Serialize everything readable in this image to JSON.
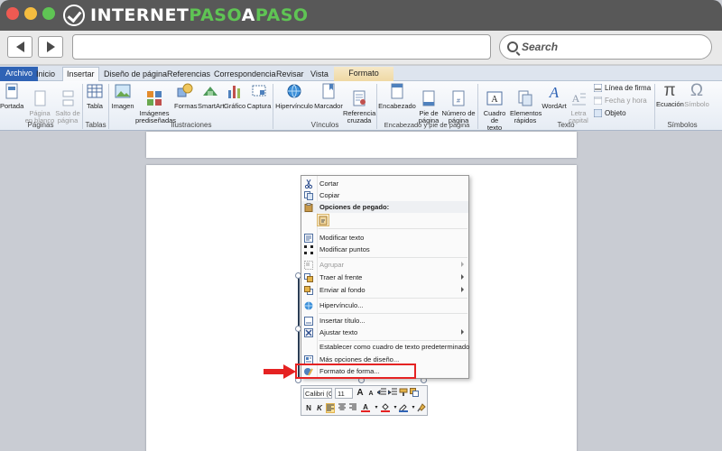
{
  "brand": {
    "part1": "INTERNET",
    "part2": "PASO",
    "mid": "A",
    "part3": "PASO",
    "accent": "#5fc454"
  },
  "browser": {
    "search_label": "Search"
  },
  "ribbon": {
    "tabs": [
      {
        "label": "Archivo",
        "kind": "file"
      },
      {
        "label": "Inicio"
      },
      {
        "label": "Insertar",
        "kind": "active"
      },
      {
        "label": "Diseño de página"
      },
      {
        "label": "Referencias"
      },
      {
        "label": "Correspondencia"
      },
      {
        "label": "Revisar"
      },
      {
        "label": "Vista"
      },
      {
        "label": "Formato",
        "kind": "ctx"
      }
    ],
    "buttons": {
      "portada": "Portada",
      "pagina_blanco": "Página\nen blanco",
      "salto_pagina": "Salto de\npágina",
      "tabla": "Tabla",
      "imagen": "Imagen",
      "imagenes_pre": "Imágenes\nprediseñadas",
      "formas": "Formas",
      "smartart": "SmartArt",
      "grafico": "Gráfico",
      "captura": "Captura",
      "hipervinculo": "Hipervínculo",
      "marcador": "Marcador",
      "referencia": "Referencia\ncruzada",
      "encabezado": "Encabezado",
      "pie_pagina": "Pie de\npágina",
      "numero_pagina": "Número de\npágina",
      "cuadro_texto": "Cuadro de\ntexto",
      "elementos_rapidos": "Elementos\nrápidos",
      "wordart": "WordArt",
      "letra_capital": "Letra\ncapital",
      "linea_firma": "Línea de firma",
      "fecha_hora": "Fecha y hora",
      "objeto": "Objeto",
      "ecuacion": "Ecuación",
      "simbolo": "Símbolo"
    },
    "groups": {
      "paginas": "Páginas",
      "tablas": "Tablas",
      "ilustraciones": "Ilustraciones",
      "vinculos": "Vínculos",
      "encabezado_pie": "Encabezado y pie de página",
      "texto": "Texto",
      "simbolos": "Símbolos"
    }
  },
  "context_menu": {
    "items": [
      {
        "label": "Cortar"
      },
      {
        "label": "Copiar"
      },
      {
        "label": "Opciones de pegado:"
      },
      {
        "label": "Modificar texto"
      },
      {
        "label": "Modificar puntos"
      },
      {
        "label": "Agrupar"
      },
      {
        "label": "Traer al frente"
      },
      {
        "label": "Enviar al fondo"
      },
      {
        "label": "Hipervínculo..."
      },
      {
        "label": "Insertar título..."
      },
      {
        "label": "Ajustar texto"
      },
      {
        "label": "Establecer como cuadro de texto predeterminado"
      },
      {
        "label": "Más opciones de diseño..."
      },
      {
        "label": "Formato de forma..."
      }
    ]
  },
  "mini_toolbar": {
    "font": "Calibri (C",
    "size": "11",
    "grow": "A",
    "shrink": "A",
    "bold": "N",
    "italic": "K",
    "font_color": "A"
  }
}
